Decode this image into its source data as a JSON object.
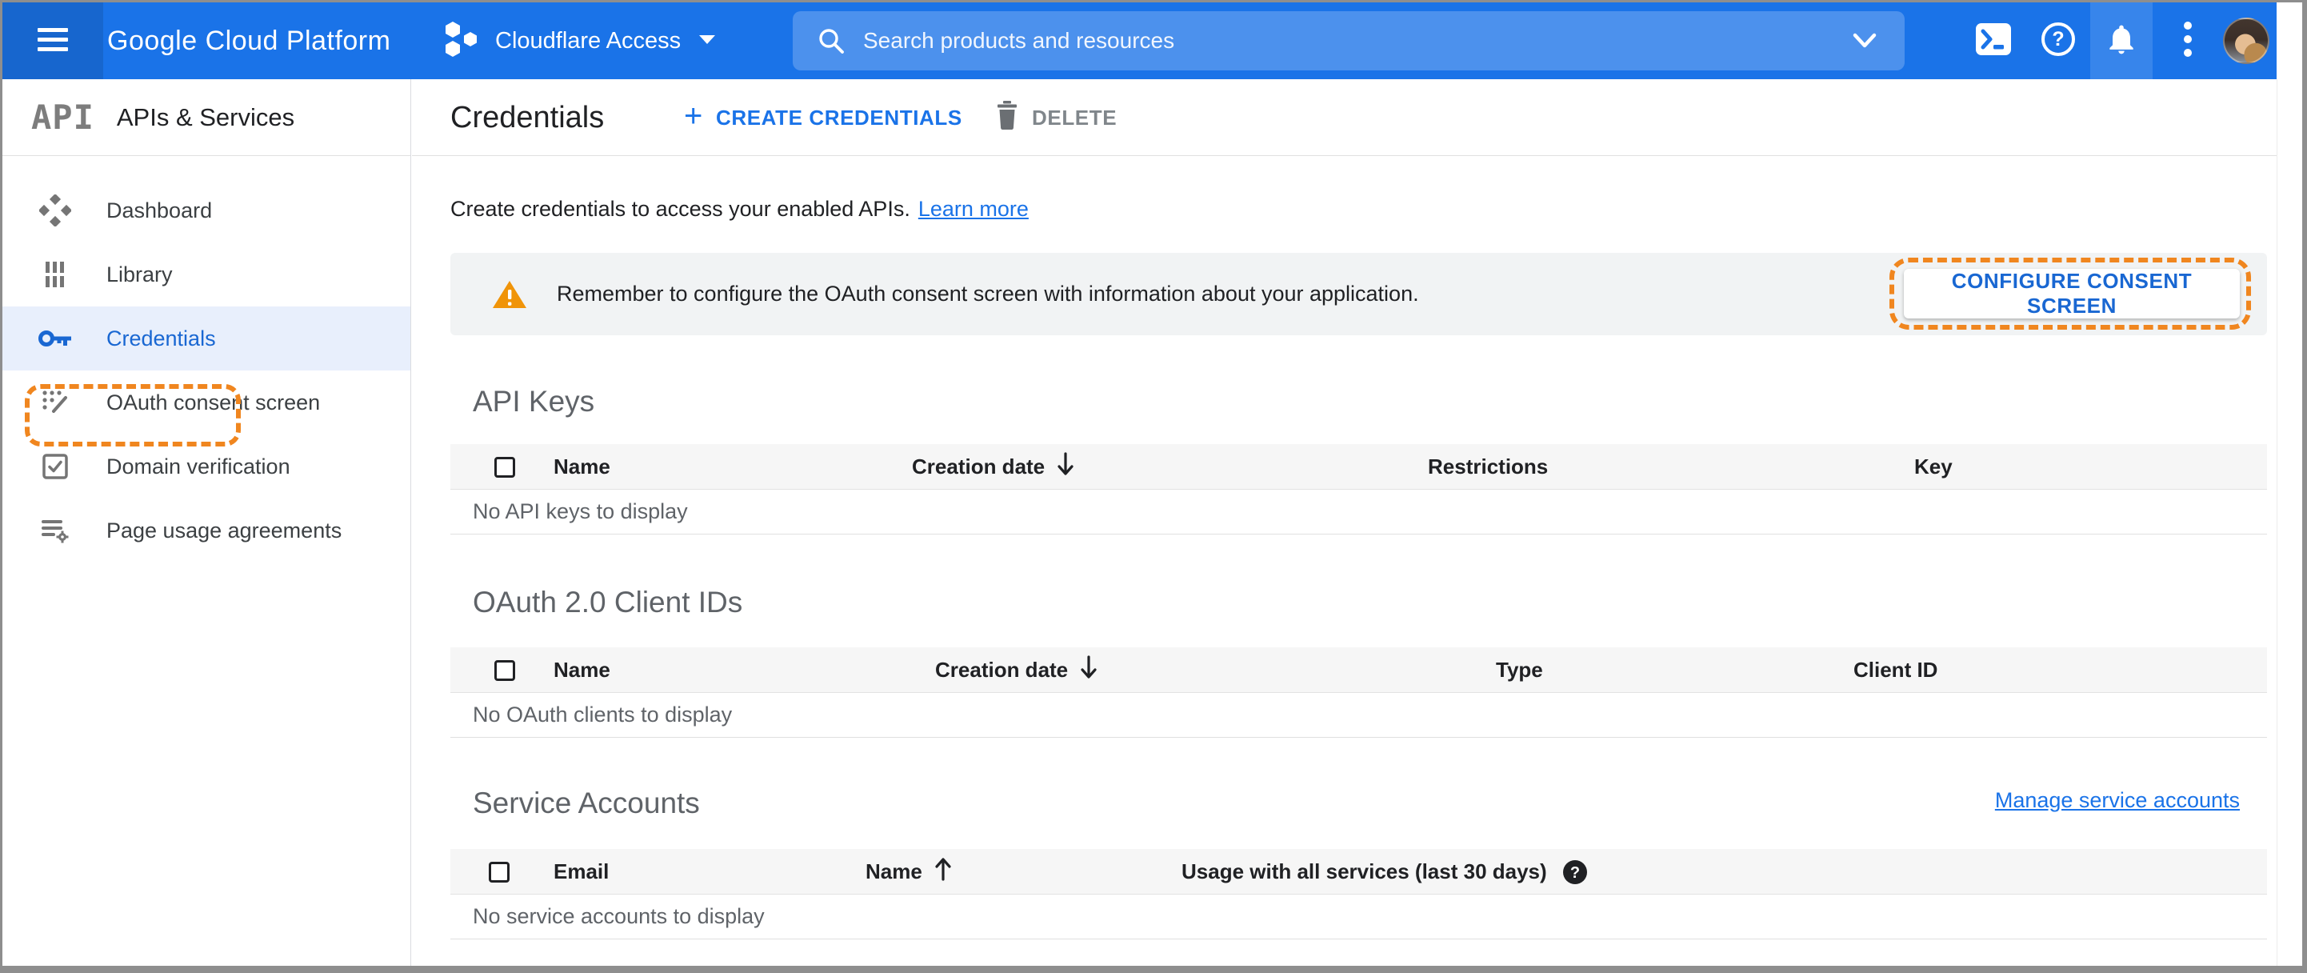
{
  "topbar": {
    "brand": "Google Cloud Platform",
    "project": "Cloudflare Access",
    "search_placeholder": "Search products and resources"
  },
  "sidebar": {
    "logo": "API",
    "title": "APIs & Services",
    "items": [
      {
        "label": "Dashboard",
        "icon": "dashboard-icon",
        "active": false
      },
      {
        "label": "Library",
        "icon": "library-icon",
        "active": false
      },
      {
        "label": "Credentials",
        "icon": "key-icon",
        "active": true,
        "annotated": true
      },
      {
        "label": "OAuth consent screen",
        "icon": "oauth-consent-icon",
        "active": false
      },
      {
        "label": "Domain verification",
        "icon": "domain-verification-icon",
        "active": false
      },
      {
        "label": "Page usage agreements",
        "icon": "page-usage-icon",
        "active": false
      }
    ]
  },
  "header": {
    "title": "Credentials",
    "create_label": "CREATE CREDENTIALS",
    "delete_label": "DELETE"
  },
  "intro": {
    "text": "Create credentials to access your enabled APIs.",
    "link": "Learn more"
  },
  "banner": {
    "message": "Remember to configure the OAuth consent screen with information about your application.",
    "button": "CONFIGURE CONSENT SCREEN"
  },
  "api_keys": {
    "title": "API Keys",
    "columns": [
      "Name",
      "Creation date",
      "Restrictions",
      "Key"
    ],
    "sorted_by": "Creation date",
    "sort_direction": "desc",
    "empty": "No API keys to display"
  },
  "oauth_clients": {
    "title": "OAuth 2.0 Client IDs",
    "columns": [
      "Name",
      "Creation date",
      "Type",
      "Client ID"
    ],
    "sorted_by": "Creation date",
    "sort_direction": "desc",
    "empty": "No OAuth clients to display"
  },
  "service_accounts": {
    "title": "Service Accounts",
    "manage_link": "Manage service accounts",
    "columns": [
      "Email",
      "Name",
      "Usage with all services (last 30 days)"
    ],
    "sorted_by": "Name",
    "sort_direction": "asc",
    "empty": "No service accounts to display"
  },
  "glyphs": {
    "plus": "+",
    "question": "?"
  },
  "colors": {
    "topbar_blue": "#1a73e8",
    "link_blue": "#1a73e8",
    "active_item_blue": "#1967d2",
    "active_item_bg": "#e8effc",
    "annotation_orange": "#f0861f",
    "warning_orange": "#f09409",
    "banner_bg": "#f1f3f4",
    "table_header_bg": "#f6f6f6"
  }
}
